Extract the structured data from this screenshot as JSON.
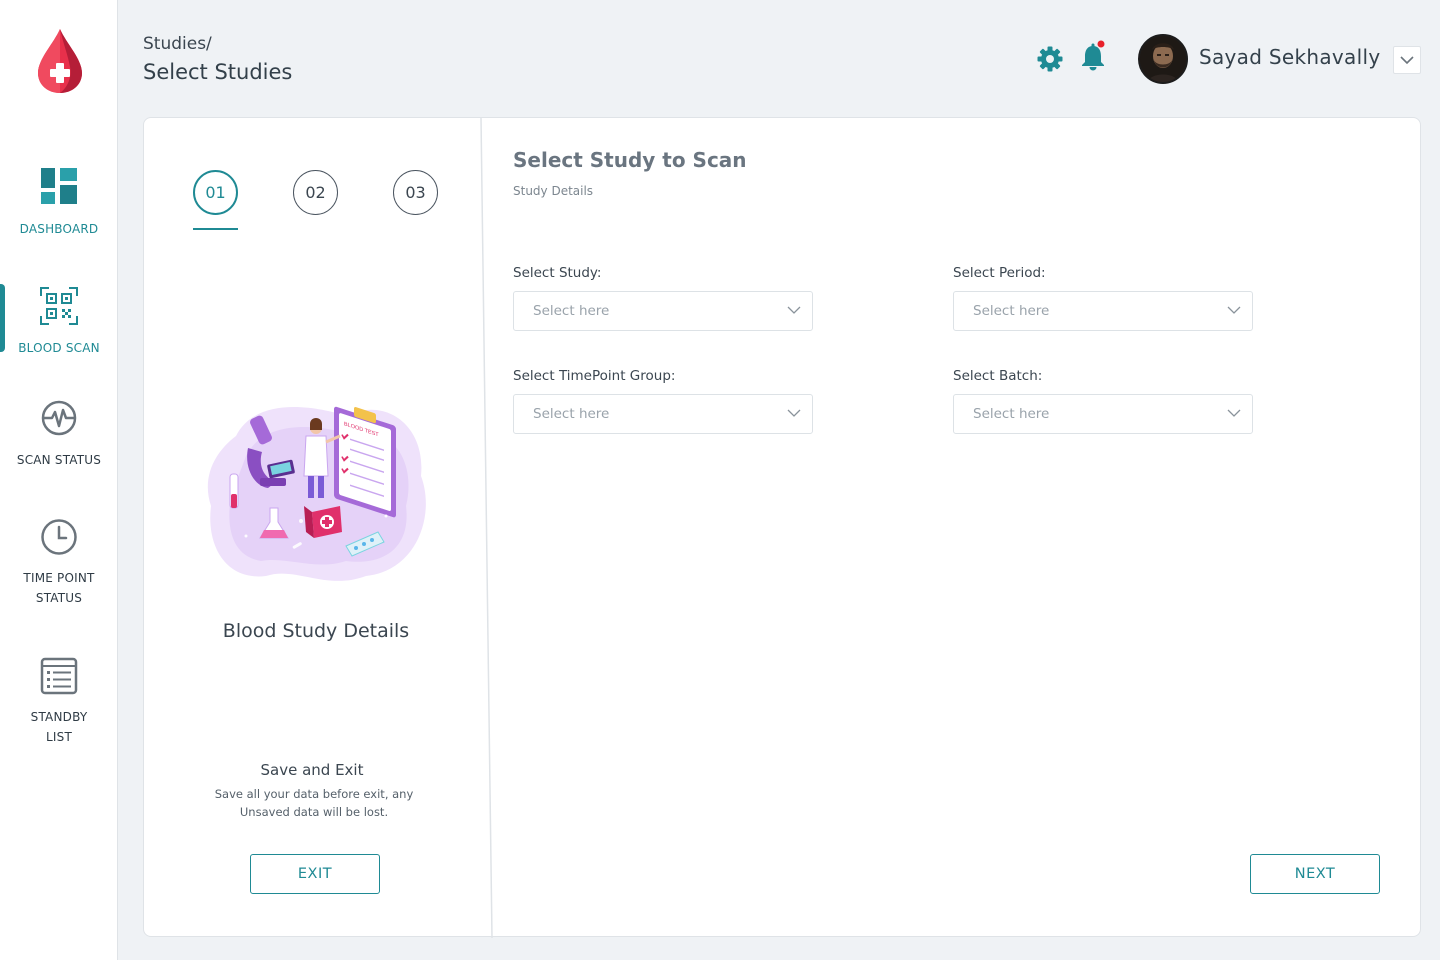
{
  "sidebar": {
    "items": [
      {
        "label": "DASHBOARD"
      },
      {
        "label": "BLOOD SCAN"
      },
      {
        "label": "SCAN STATUS"
      },
      {
        "label": "TIME POINT STATUS"
      },
      {
        "label": "STANDBY LIST"
      }
    ]
  },
  "header": {
    "breadcrumb": "Studies/",
    "title": "Select Studies",
    "user_name": "Sayad Sekhavally"
  },
  "steps": [
    "01",
    "02",
    "03"
  ],
  "left_panel": {
    "heading": "Blood Study Details",
    "illustration_text": "BLOOD TEST",
    "save_title": "Save and Exit",
    "save_desc": "Save all your data before exit, any Unsaved data will be lost.",
    "exit_label": "EXIT"
  },
  "form": {
    "title": "Select Study to Scan",
    "subtitle": "Study Details",
    "fields": [
      {
        "label": "Select Study:",
        "placeholder": "Select here"
      },
      {
        "label": "Select Period:",
        "placeholder": "Select here"
      },
      {
        "label": "Select TimePoint Group:",
        "placeholder": "Select here"
      },
      {
        "label": "Select Batch:",
        "placeholder": "Select here"
      }
    ],
    "next_label": "NEXT"
  },
  "colors": {
    "accent": "#1f8a94",
    "logo_red": "#e8304b",
    "notification_dot": "#e8202a",
    "illustration_purple": "#a56ad8"
  },
  "icons": [
    "blood-drop-logo-icon",
    "dashboard-icon",
    "qr-code-icon",
    "pulse-icon",
    "clock-icon",
    "list-icon",
    "gear-icon",
    "bell-icon",
    "chevron-down-icon"
  ]
}
